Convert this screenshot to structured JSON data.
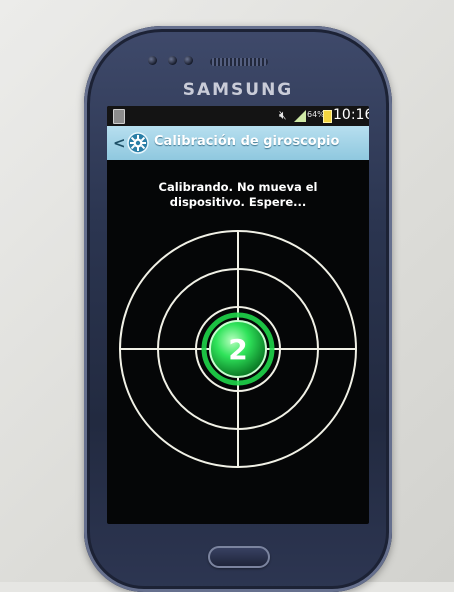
{
  "device": {
    "brand": "SAMSUNG"
  },
  "status_bar": {
    "battery_percent": "64%",
    "time": "10:16"
  },
  "title_bar": {
    "title": "Calibración de giroscopio"
  },
  "calibration": {
    "instruction": "Calibrando. No mueva el dispositivo. Espere...",
    "indicator_number": "2",
    "indicator_color": "#1fd64a"
  }
}
